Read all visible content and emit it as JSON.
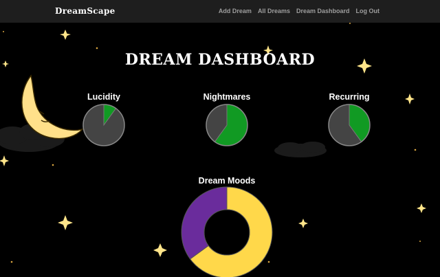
{
  "nav": {
    "brand": "DreamScape",
    "links": [
      "Add Dream",
      "All Dreams",
      "Dream Dashboard",
      "Log Out"
    ]
  },
  "page": {
    "title": "DREAM DASHBOARD"
  },
  "colors": {
    "navbar": "#1e1e1e",
    "background": "#000000",
    "pie_green": "#119a23",
    "pie_gray": "#444444",
    "mood_purple": "#6a2c9c",
    "mood_yellow": "#ffd84a",
    "star": "#ffe58a",
    "moon": "#ffe08a"
  },
  "chart_data": [
    {
      "type": "pie",
      "title": "Lucidity",
      "values": [
        10,
        90
      ]
    },
    {
      "type": "pie",
      "title": "Nightmares",
      "values": [
        60,
        40
      ]
    },
    {
      "type": "pie",
      "title": "Recurring",
      "values": [
        40,
        60
      ]
    },
    {
      "type": "pie",
      "title": "Dream Moods",
      "values": [
        35,
        65
      ]
    }
  ]
}
